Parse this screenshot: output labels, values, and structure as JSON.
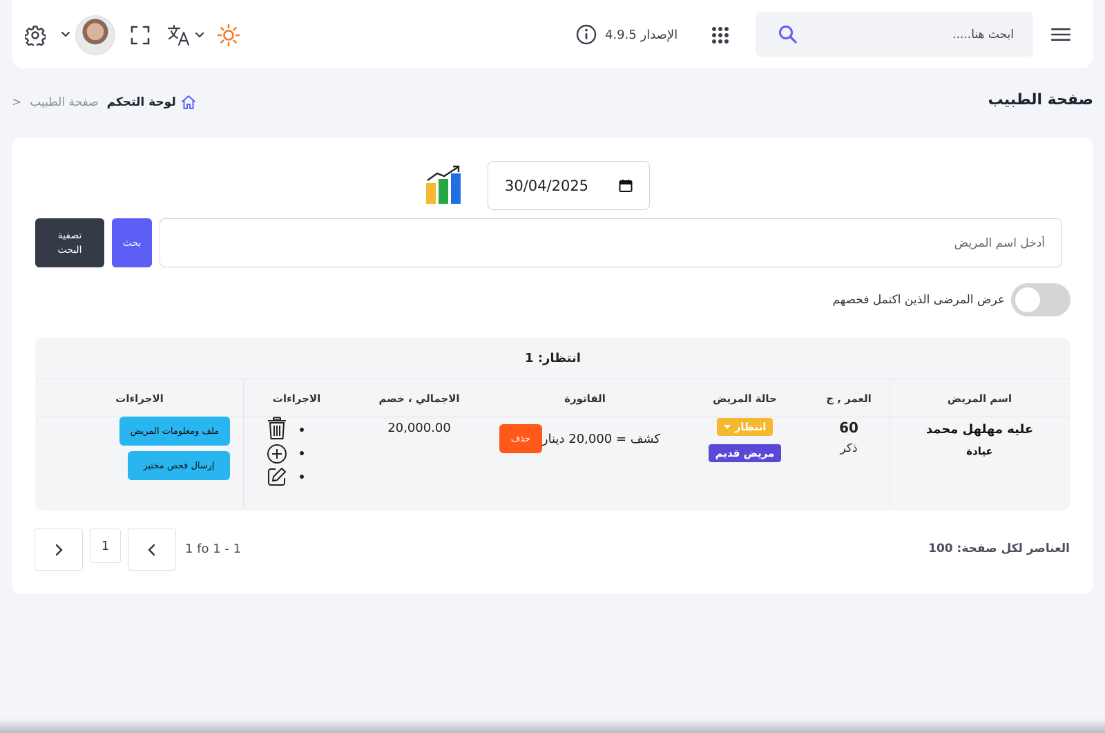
{
  "header": {
    "search_placeholder": "ابحث هنا.....",
    "version_label": "الإصدار 4.9.5"
  },
  "page": {
    "title": "صفحة الطبيب",
    "breadcrumb": {
      "home": "لوحة التحكم",
      "current": "صفحة الطبيب",
      "separator": ">"
    }
  },
  "filters": {
    "date_value": "30/04/2025",
    "name_placeholder": "أدخل اسم المريض",
    "search_button": "بحث",
    "clear_button_line1": "تصفية",
    "clear_button_line2": "البحث",
    "toggle_label": "عرض المرضى الذين اكتمل فحصهم",
    "toggle_on": false
  },
  "table": {
    "group_title": "انتظار: 1",
    "columns": {
      "patient_name": "اسم المريض",
      "age": "العمر , ج",
      "status": "حالة المريض",
      "invoice": "الفاتورة",
      "total": "الاجمالي ، خصم",
      "actions1": "الاجراءات",
      "actions2": "الاجراءات"
    },
    "row": {
      "name": "عليه مهلهل محمد",
      "visit_type": "عيادة",
      "age": "60",
      "gender": "ذكر",
      "status": "انتظار",
      "patient_type": "مريض قديم",
      "invoice_text": "كشف = 20,000 دينار",
      "delete_button": "حذف",
      "total": "20,000.00",
      "file_button": "ملف ومعلومات المريض",
      "lab_button": "إرسال فحص مختبر"
    }
  },
  "pagination": {
    "range": "1 - 1 of 1",
    "page": "1",
    "per_page_label": "العناصر لكل صفحة: 100"
  },
  "colors": {
    "primary": "#5b5ff5",
    "waiting": "#f5b82e",
    "old_patient": "#5b49d6",
    "delete": "#ff5a1a",
    "cyan": "#29b6f0",
    "dark": "#343a46",
    "sun": "#f57c2b"
  }
}
